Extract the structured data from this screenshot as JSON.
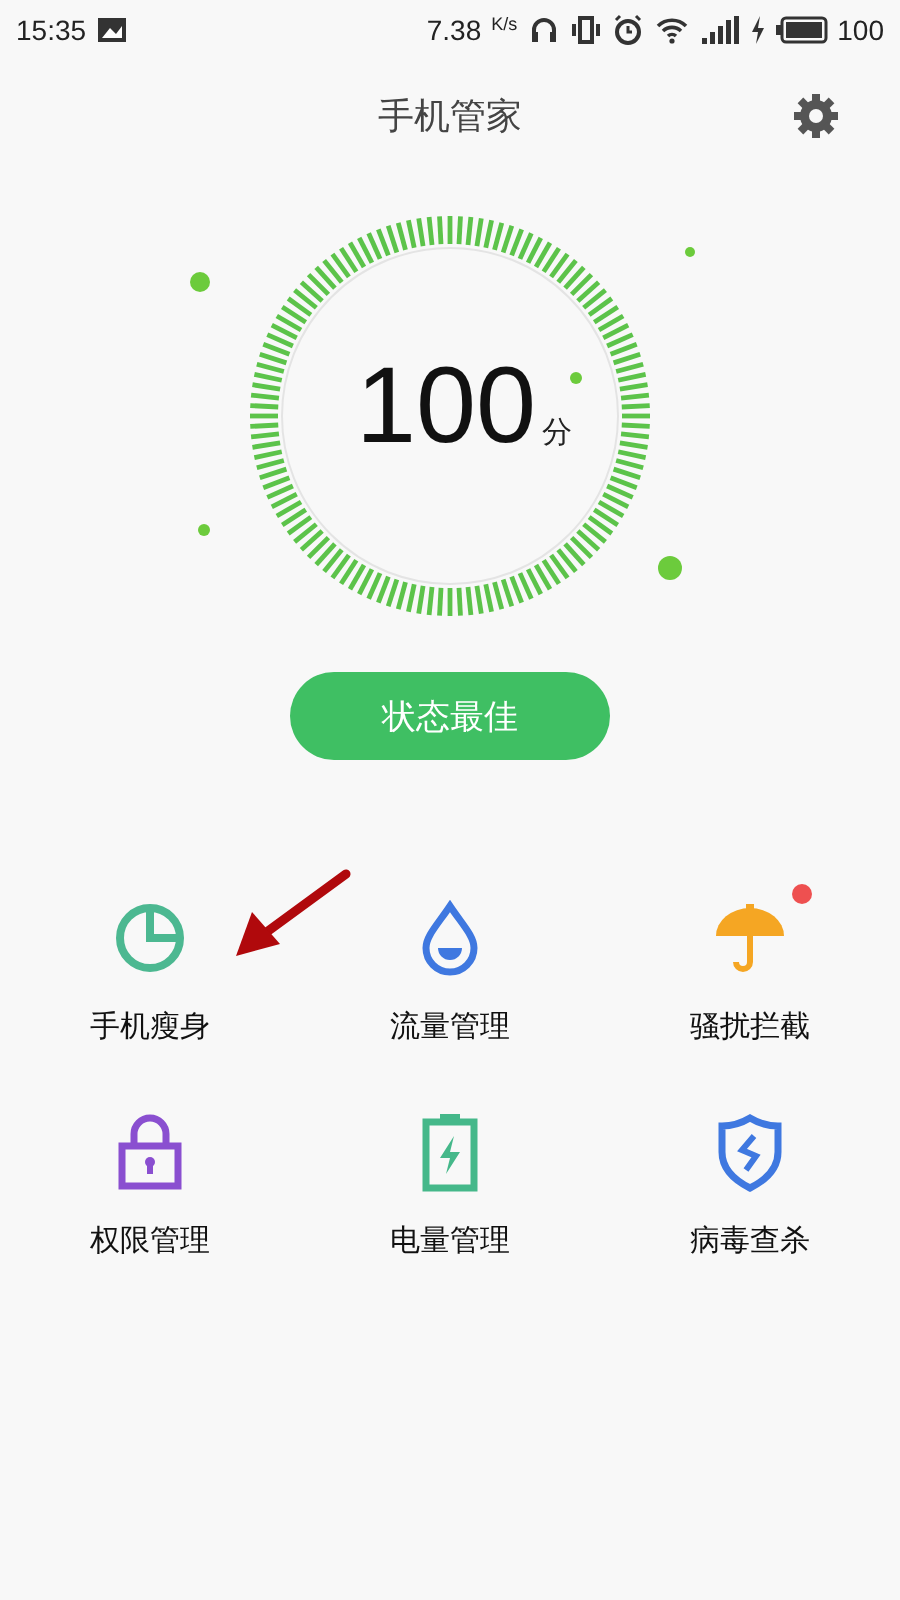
{
  "status_bar": {
    "time": "15:35",
    "speed": "7.38",
    "speed_unit": "K/s",
    "battery": "100"
  },
  "header": {
    "title": "手机管家"
  },
  "score": {
    "value": "100",
    "unit": "分"
  },
  "status_button": {
    "label": "状态最佳"
  },
  "tools": [
    {
      "label": "手机瘦身",
      "kind": "pie",
      "color": "#4cb891",
      "badge": false
    },
    {
      "label": "流量管理",
      "kind": "drop",
      "color": "#3f78e0",
      "badge": false
    },
    {
      "label": "骚扰拦截",
      "kind": "umbrella",
      "color": "#f5a623",
      "badge": true
    },
    {
      "label": "权限管理",
      "kind": "lock",
      "color": "#8a4fd0",
      "badge": false
    },
    {
      "label": "电量管理",
      "kind": "battery",
      "color": "#45b88a",
      "badge": false
    },
    {
      "label": "病毒查杀",
      "kind": "shield",
      "color": "#3f78e0",
      "badge": false
    }
  ]
}
